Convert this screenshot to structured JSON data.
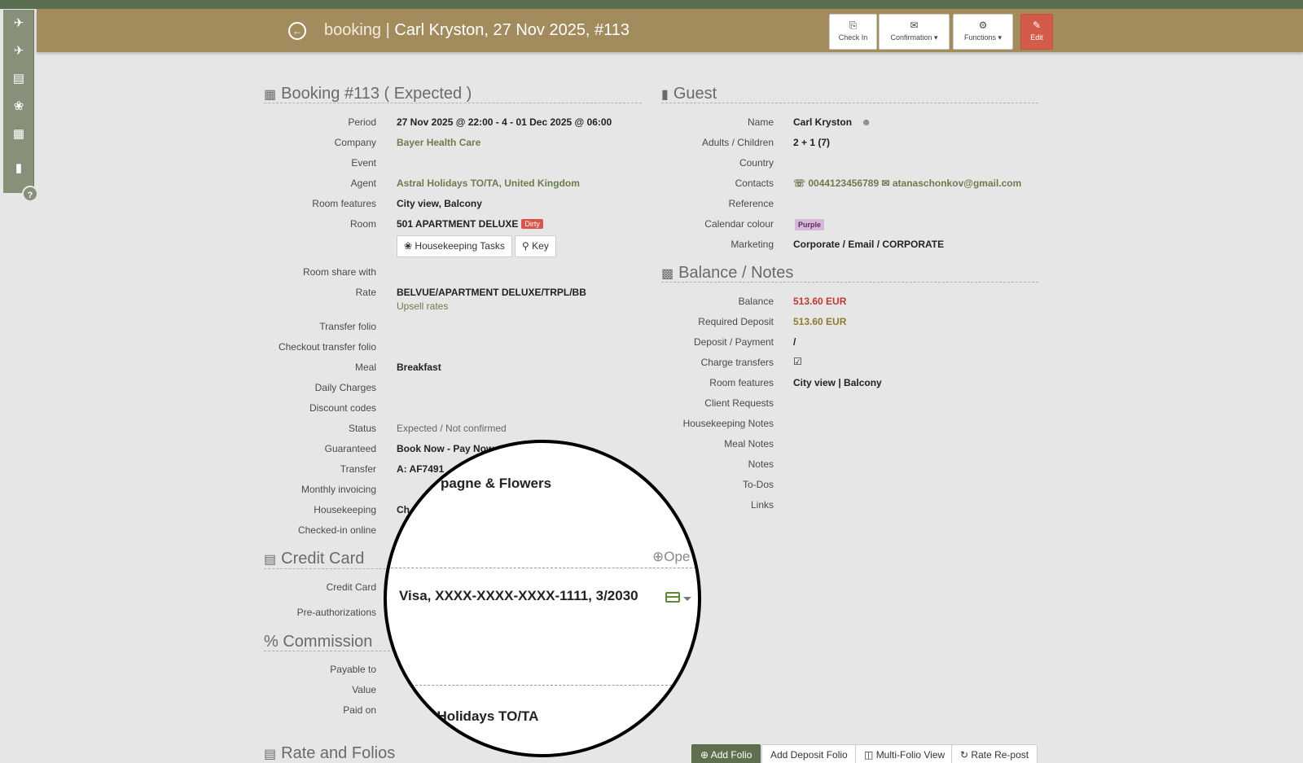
{
  "header": {
    "title_prefix": "booking |",
    "title_main": "Carl Kryston, 27 Nov 2025, #113",
    "buttons": {
      "checkin": "Check In",
      "confirmation": "Confirmation ▾",
      "functions": "Functions ▾",
      "edit": "Edit"
    }
  },
  "sidebar": {
    "icons": [
      "arrivals-icon",
      "departures-icon",
      "rooms-icon",
      "housekeeping-icon",
      "calendar-icon",
      "bookings-icon"
    ],
    "help": "?"
  },
  "booking": {
    "title": "Booking #113 ( Expected )",
    "fields": {
      "period_label": "Period",
      "period": "27 Nov 2025 @ 22:00 - 4 - 01 Dec 2025 @ 06:00",
      "company_label": "Company",
      "company": "Bayer Health Care",
      "event_label": "Event",
      "agent_label": "Agent",
      "agent": "Astral Holidays TO/TA, United Kingdom",
      "room_features_label": "Room features",
      "room_features": "City view, Balcony",
      "room_label": "Room",
      "room": "501 APARTMENT DELUXE",
      "room_status": "Dirty",
      "hk_tasks_button": "Housekeeping Tasks",
      "key_button": "Key",
      "room_share_label": "Room share with",
      "rate_label": "Rate",
      "rate": "BELVUE/APARTMENT DELUXE/TRPL/BB",
      "upsell": "Upsell rates",
      "transfer_folio_label": "Transfer folio",
      "checkout_transfer_label": "Checkout transfer folio",
      "meal_label": "Meal",
      "meal": "Breakfast",
      "daily_charges_label": "Daily Charges",
      "discount_label": "Discount codes",
      "status_label": "Status",
      "status": "Expected / Not confirmed",
      "guaranteed_label": "Guaranteed",
      "guaranteed": "Book Now - Pay Now",
      "transfer_label": "Transfer",
      "transfer": "A: AF7491",
      "monthly_label": "Monthly invoicing",
      "housekeeping_label": "Housekeeping",
      "housekeeping": "Ch",
      "checked_in_online_label": "Checked-in online"
    }
  },
  "credit_card": {
    "title": "Credit Card",
    "card_label": "Credit Card",
    "preauth_label": "Pre-authorizations"
  },
  "commission": {
    "title": "Commission",
    "title_prefix": "%",
    "payable_label": "Payable to",
    "value_label": "Value",
    "paid_label": "Paid on"
  },
  "rate_folios": {
    "title": "Rate and Folios",
    "buttons": {
      "add_folio": "Add Folio",
      "add_deposit": "Add Deposit Folio",
      "multi": "Multi-Folio View",
      "repost": "Rate Re-post"
    }
  },
  "guest": {
    "title": "Guest",
    "name_label": "Name",
    "name": "Carl Kryston",
    "adults_label": "Adults / Children",
    "adults": "2 + 1 (7)",
    "country_label": "Country",
    "contacts_label": "Contacts",
    "phone": "0044123456789",
    "email": "atanaschonkov@gmail.com",
    "reference_label": "Reference",
    "calendar_label": "Calendar colour",
    "calendar_colour": "Purple",
    "marketing_label": "Marketing",
    "marketing": "Corporate / Email / CORPORATE"
  },
  "balance": {
    "title": "Balance / Notes",
    "balance_label": "Balance",
    "balance": "513.60 EUR",
    "required_label": "Required Deposit",
    "required": "513.60 EUR",
    "deposit_label": "Deposit / Payment",
    "deposit": "/",
    "charge_label": "Charge transfers",
    "charge": "☑",
    "room_features_label": "Room features",
    "room_features": "City view | Balcony",
    "client_req_label": "Client Requests",
    "hk_notes_label": "Housekeeping Notes",
    "meal_notes_label": "Meal Notes",
    "notes_label": "Notes",
    "todos_label": "To-Dos",
    "links_label": "Links"
  },
  "magnifier": {
    "champagne": "pagne & Flowers",
    "open": "Ope",
    "card": "Visa, XXXX-XXXX-XXXX-1111, 3/2030",
    "agent": "l Holidays TO/TA"
  },
  "colors": {
    "header": "#a28b5d",
    "topstrip": "#5c6e52",
    "sidebar": "#879079",
    "edit": "#d45b4a",
    "link": "#6b7d4f",
    "balance": "#c0392b"
  }
}
